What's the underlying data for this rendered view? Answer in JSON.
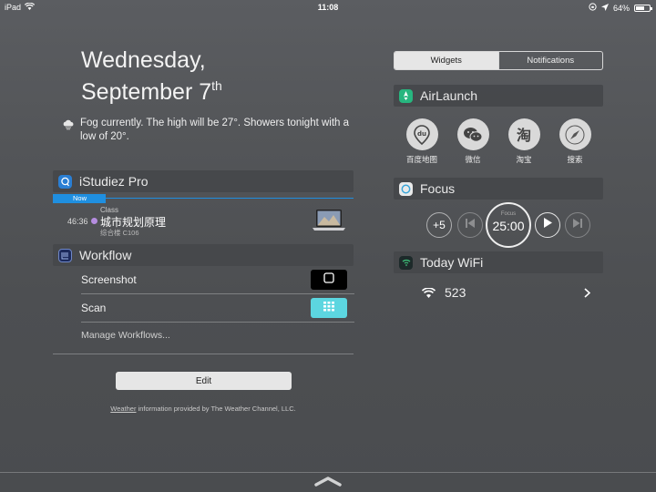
{
  "status_bar": {
    "device": "iPad",
    "time": "11:08",
    "battery": "64%",
    "battery_level": 0.64
  },
  "date": {
    "weekday": "Wednesday,",
    "month_day": "September 7",
    "suffix": "th"
  },
  "weather": {
    "text": "Fog currently. The high will be 27°. Showers tonight with a low of 20°.",
    "icon": "cloud-icon"
  },
  "istudiez": {
    "title": "iStudiez Pro",
    "now_label": "Now",
    "class_time": "46:36",
    "class_type": "Class",
    "class_name": "城市规划原理",
    "class_room": "综合楼 C106",
    "dot_color": "#b58de0"
  },
  "workflow": {
    "title": "Workflow",
    "items": [
      {
        "label": "Screenshot",
        "color": "#000000"
      },
      {
        "label": "Scan",
        "color": "#5cd6e0"
      }
    ],
    "manage": "Manage Workflows..."
  },
  "edit_button": "Edit",
  "footer": {
    "link": "Weather",
    "text": " information provided by The Weather Channel, LLC."
  },
  "segmented": {
    "widgets": "Widgets",
    "notifications": "Notifications"
  },
  "airlaunch": {
    "title": "AirLaunch",
    "items": [
      {
        "label": "百度地图",
        "icon": "baidu-map-icon"
      },
      {
        "label": "微信",
        "icon": "wechat-icon"
      },
      {
        "label": "淘宝",
        "icon": "taobao-icon"
      },
      {
        "label": "搜索",
        "icon": "safari-compass-icon"
      }
    ]
  },
  "focus": {
    "title": "Focus",
    "plus": "+5",
    "timer_label": "Focus",
    "timer": "25:00"
  },
  "today_wifi": {
    "title": "Today WiFi",
    "network": "523"
  }
}
